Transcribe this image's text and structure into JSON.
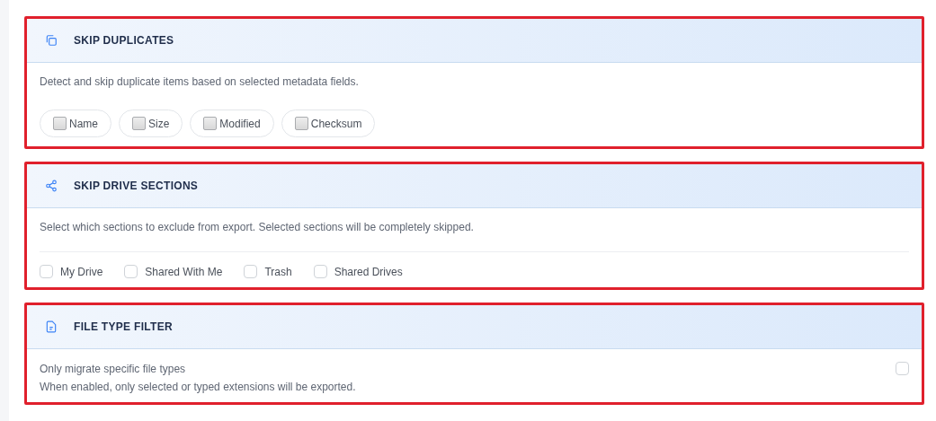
{
  "sections": [
    {
      "kind": "chips",
      "title": "SKIP DUPLICATES",
      "highlighted": true,
      "description": "Detect and skip duplicate items based on selected metadata fields.",
      "options": [
        {
          "label": "Name",
          "checked": false
        },
        {
          "label": "Size",
          "checked": false
        },
        {
          "label": "Modified",
          "checked": false
        },
        {
          "label": "Checksum",
          "checked": false
        }
      ]
    },
    {
      "kind": "checks",
      "title": "SKIP DRIVE SECTIONS",
      "highlighted": true,
      "description": "Select which sections to exclude from export. Selected sections will be completely skipped.",
      "options": [
        {
          "label": "My Drive",
          "checked": false
        },
        {
          "label": "Shared With Me",
          "checked": false
        },
        {
          "label": "Trash",
          "checked": false
        },
        {
          "label": "Shared Drives",
          "checked": false
        }
      ]
    },
    {
      "kind": "toggle",
      "title": "FILE TYPE FILTER",
      "highlighted": true,
      "description": "Only migrate specific file types",
      "checked": false,
      "note": "When enabled, only selected or typed extensions will be exported."
    }
  ]
}
